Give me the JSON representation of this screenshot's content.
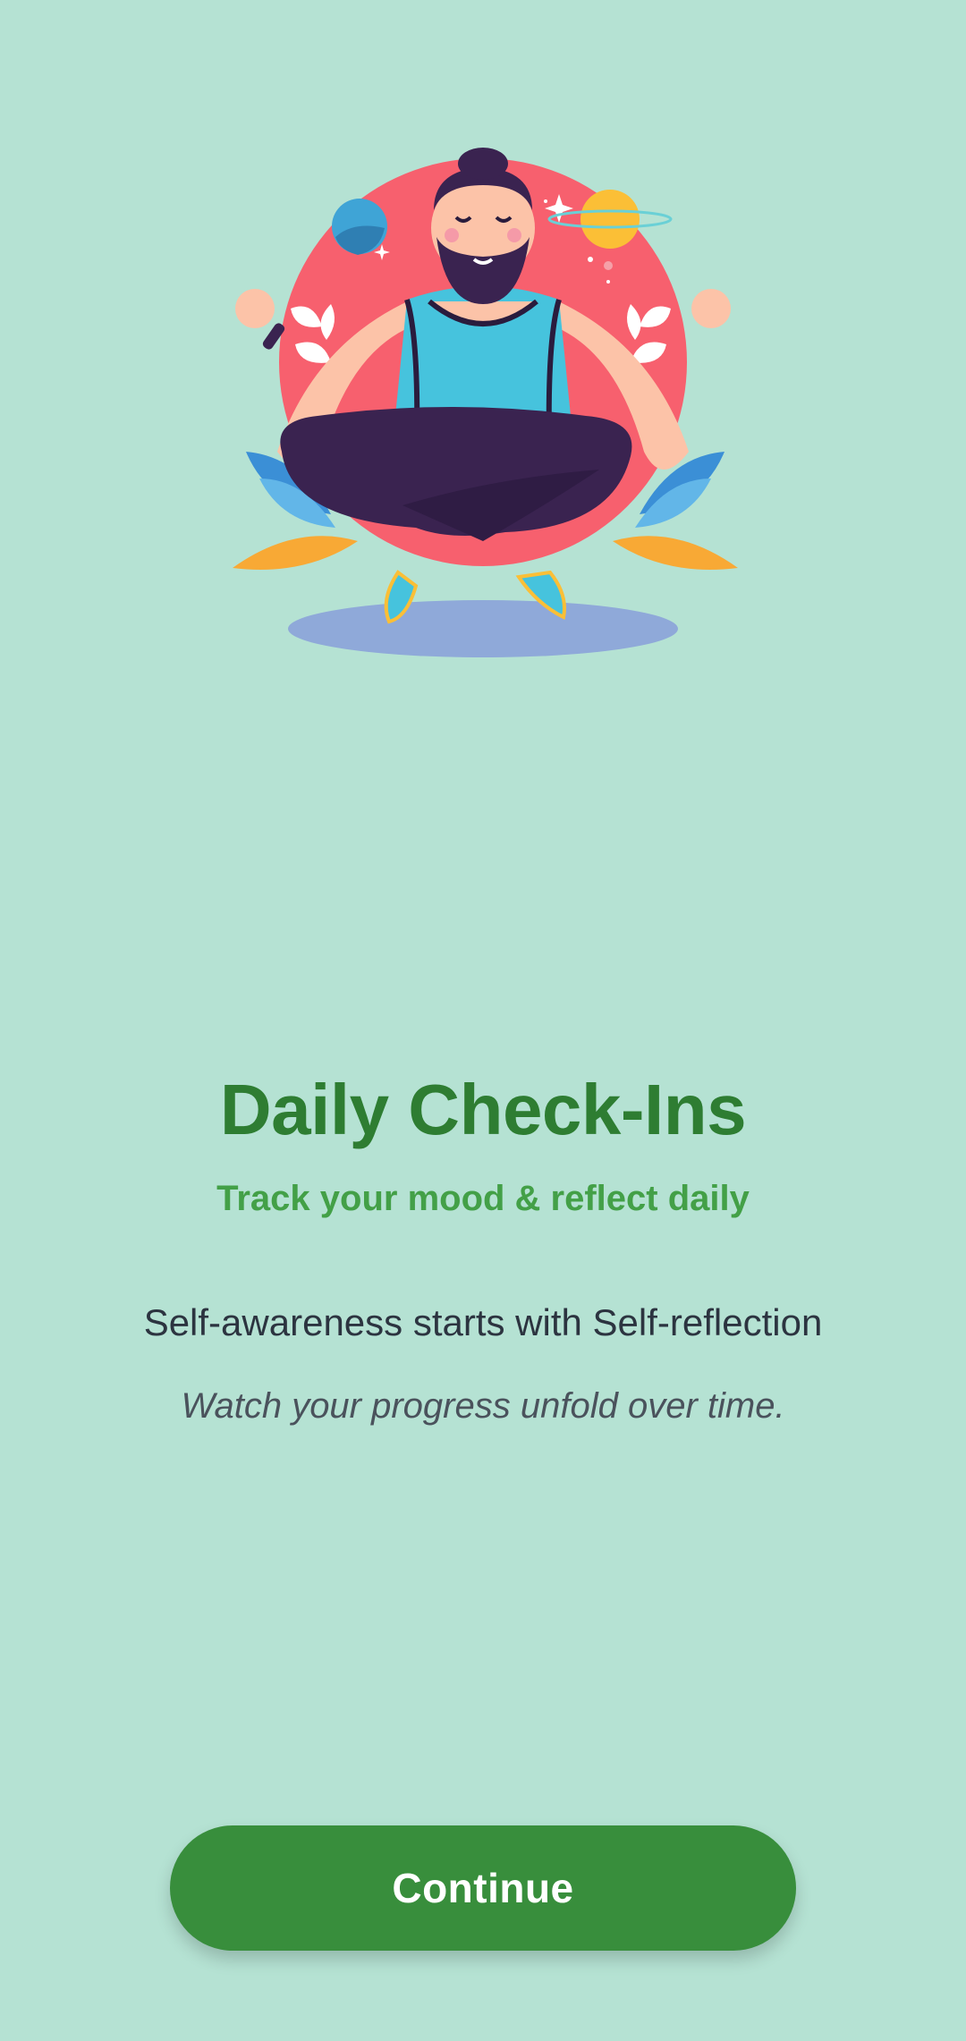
{
  "onboarding": {
    "illustration": "meditating-person-illustration",
    "title": "Daily Check-Ins",
    "subtitle": "Track your mood & reflect daily",
    "description": "Self-awareness starts with Self-reflection",
    "tagline": "Watch your progress unfold over time.",
    "continue_label": "Continue"
  },
  "colors": {
    "background": "#b5e2d3",
    "title": "#2e7d32",
    "subtitle": "#43a047",
    "button": "#388e3c",
    "button_text": "#ffffff"
  }
}
